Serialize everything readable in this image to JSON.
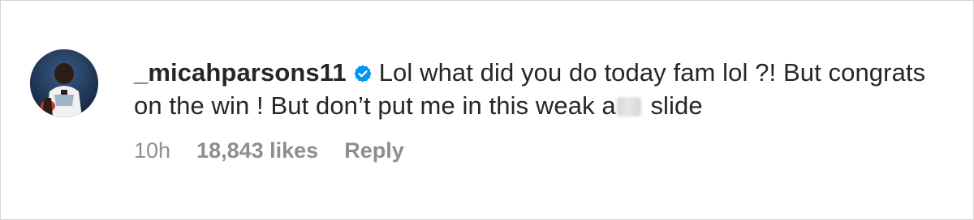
{
  "comment": {
    "username": "_micahparsons11",
    "verified_icon": "verified-badge-icon",
    "text_part1": "Lol what did you do today fam lol ?! But congrats on the win ! But don’t put me in this weak a",
    "text_part2": " slide",
    "time": "10h",
    "likes": "18,843 likes",
    "reply": "Reply"
  },
  "colors": {
    "text": "#262626",
    "meta": "#8e8e8e",
    "verified": "#0095f6",
    "border": "#d4d4d4"
  }
}
